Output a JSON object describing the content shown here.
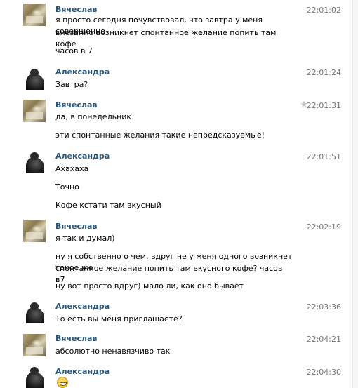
{
  "messages": [
    {
      "author": "Вячеслав",
      "time": "22:01:02",
      "avatar": "avatar-photo-vyacheslav",
      "lines": [
        "я просто сегодня почувствовал, что завтра у меня совершенно",
        "внезапно возникнет спонтанное желание попить там кофе",
        "часов в 7"
      ]
    },
    {
      "author": "Александра",
      "time": "22:01:24",
      "avatar": "avatar-photo-aleksandra",
      "lines": [
        "Завтра?"
      ]
    },
    {
      "author": "Вячеслав",
      "time": "22:01:31",
      "avatar": "avatar-photo-vyacheslav",
      "star_icon": "star-icon",
      "lines": [
        "да, в понедельник",
        "эти спонтанные желания такие непредсказуемые!"
      ]
    },
    {
      "author": "Александра",
      "time": "22:01:51",
      "avatar": "avatar-photo-aleksandra",
      "lines": [
        "Ахахаха",
        "Точно",
        "Кофе кстати там вкусный"
      ]
    },
    {
      "author": "Вячеслав",
      "time": "22:02:19",
      "avatar": "avatar-photo-vyacheslav",
      "lines": [
        "я так и думал)",
        "ну я собственно о чем. вдруг не у меня одного возникнет такое же",
        "спонтанное желание попить там вкусного кофе? часов в7",
        "ну вот просто вдруг) мало ли, как оно бывает"
      ]
    },
    {
      "author": "Александра",
      "time": "22:03:36",
      "avatar": "avatar-photo-aleksandra",
      "lines": [
        "То есть вы меня приглашаете?"
      ]
    },
    {
      "author": "Вячеслав",
      "time": "22:04:21",
      "avatar": "avatar-photo-vyacheslav",
      "lines": [
        "абсолютно ненавязчиво так"
      ]
    },
    {
      "author": "Александра",
      "time": "22:04:30",
      "avatar": "avatar-photo-aleksandra",
      "emoji": "grinning-emoji-icon",
      "lines": []
    }
  ],
  "colors": {
    "author": "#2b587a",
    "time": "#777777",
    "text": "#000000",
    "background": "#ffffff"
  }
}
